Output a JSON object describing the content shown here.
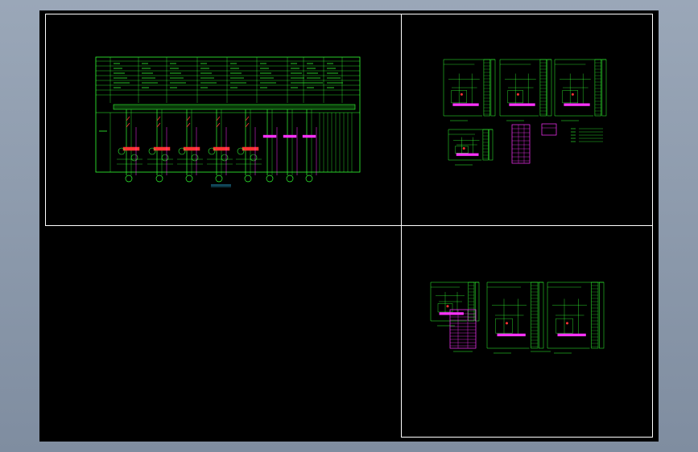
{
  "colors": {
    "background": "#000000",
    "frame": "#ffffff",
    "line_primary": "#33ff33",
    "line_accent": "#ff33ff",
    "line_alert": "#ff3333",
    "line_highlight": "#33ccff",
    "app_chrome": "#8a97a8"
  },
  "drawing": {
    "main_panel": {
      "feeder_count": 8,
      "caption": ""
    },
    "top_right_panel": {
      "sheet_count": 3
    },
    "bottom_right_panel": {
      "sheet_count": 3
    }
  }
}
